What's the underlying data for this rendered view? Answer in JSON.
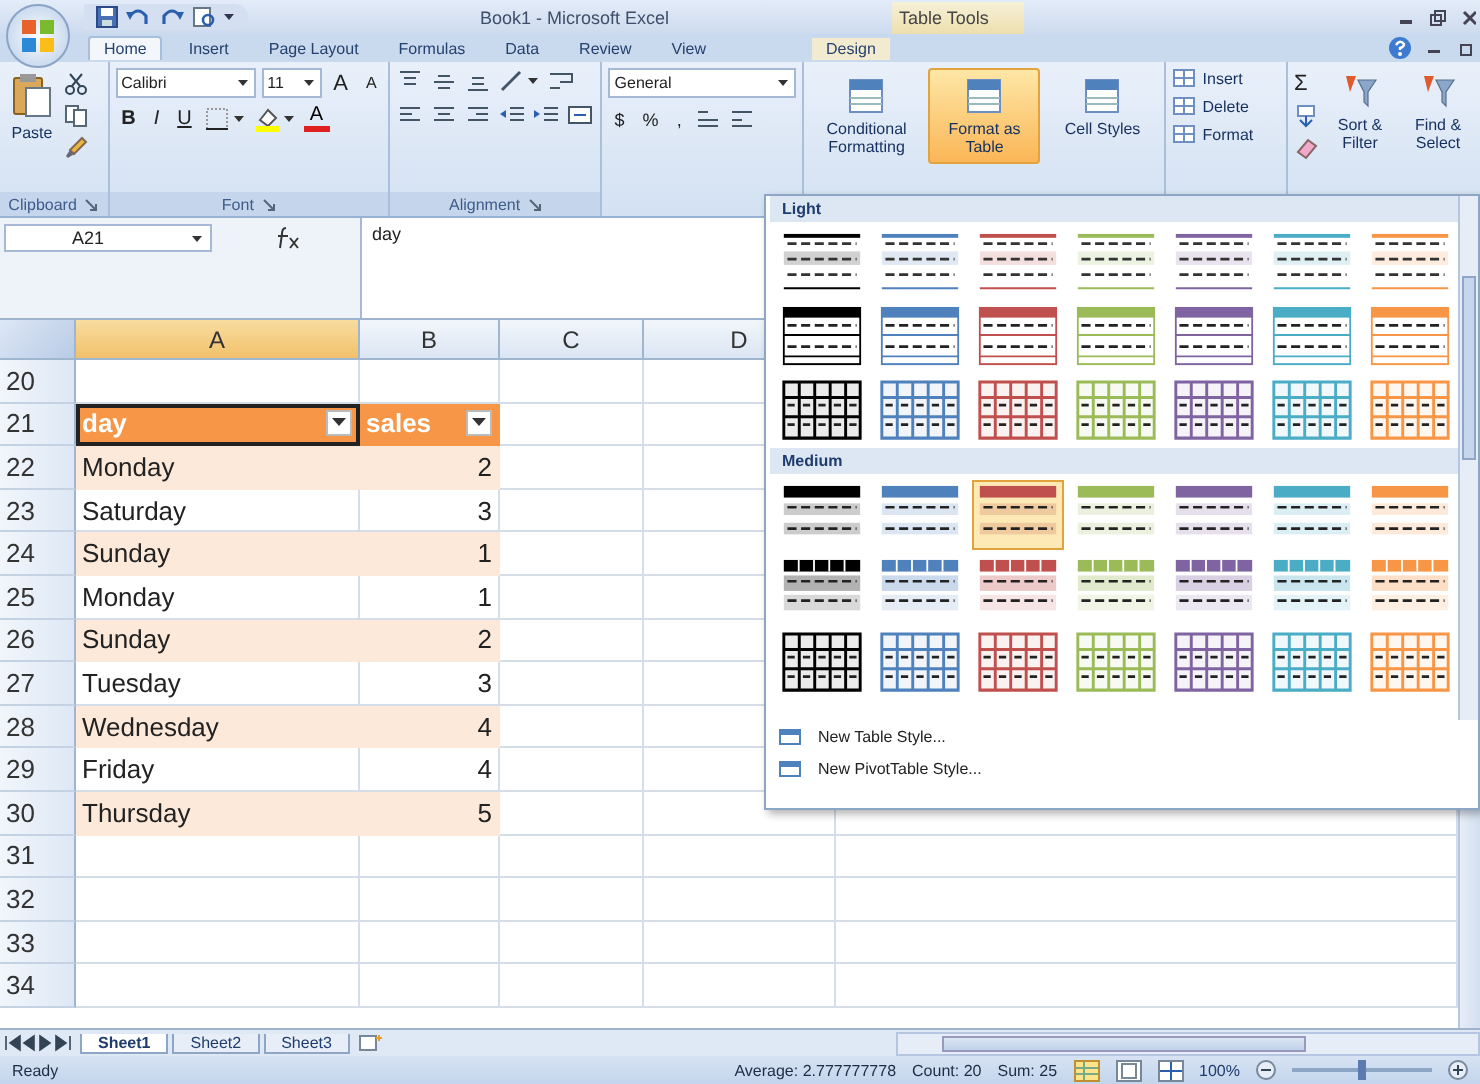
{
  "window": {
    "title": "Book1 - Microsoft Excel",
    "contextual_title": "Table Tools"
  },
  "tabs": [
    {
      "label": "Home",
      "selected": true,
      "kind": "normal"
    },
    {
      "label": "Insert",
      "selected": false,
      "kind": "normal"
    },
    {
      "label": "Page Layout",
      "selected": false,
      "kind": "normal"
    },
    {
      "label": "Formulas",
      "selected": false,
      "kind": "normal"
    },
    {
      "label": "Data",
      "selected": false,
      "kind": "normal"
    },
    {
      "label": "Review",
      "selected": false,
      "kind": "normal"
    },
    {
      "label": "View",
      "selected": false,
      "kind": "normal"
    },
    {
      "label": "Design",
      "selected": false,
      "kind": "contextual"
    }
  ],
  "ribbon": {
    "clipboard": {
      "paste": "Paste",
      "label": "Clipboard"
    },
    "font": {
      "name": "Calibri",
      "size": "11",
      "grow": "A",
      "shrink": "A",
      "styles": [
        "B",
        "I",
        "U"
      ],
      "color_letter": "A",
      "label": "Font"
    },
    "alignment": {
      "label": "Alignment"
    },
    "number": {
      "format": "General",
      "symbols": [
        "$",
        "%",
        ","
      ]
    },
    "styles": [
      {
        "label": "Conditional Formatting",
        "active": false
      },
      {
        "label": "Format as Table",
        "active": true
      },
      {
        "label": "Cell Styles",
        "active": false
      }
    ],
    "cells": [
      "Insert",
      "Delete",
      "Format"
    ],
    "editing": {
      "sum": "Σ",
      "buttons": [
        "Sort & Filter",
        "Find & Select"
      ]
    }
  },
  "name_box": "A21",
  "formula": "day",
  "columns": [
    "A",
    "B",
    "C",
    "D"
  ],
  "rows": [
    {
      "number": "20",
      "kind": "empty"
    },
    {
      "number": "21",
      "kind": "header",
      "day": "day",
      "sales": "sales"
    },
    {
      "number": "22",
      "kind": "data",
      "day": "Monday",
      "sales": "2",
      "banded": true
    },
    {
      "number": "23",
      "kind": "data",
      "day": "Saturday",
      "sales": "3",
      "banded": false
    },
    {
      "number": "24",
      "kind": "data",
      "day": "Sunday",
      "sales": "1",
      "banded": true
    },
    {
      "number": "25",
      "kind": "data",
      "day": "Monday",
      "sales": "1",
      "banded": false
    },
    {
      "number": "26",
      "kind": "data",
      "day": "Sunday",
      "sales": "2",
      "banded": true
    },
    {
      "number": "27",
      "kind": "data",
      "day": "Tuesday",
      "sales": "3",
      "banded": false
    },
    {
      "number": "28",
      "kind": "data",
      "day": "Wednesday",
      "sales": "4",
      "banded": true
    },
    {
      "number": "29",
      "kind": "data",
      "day": "Friday",
      "sales": "4",
      "banded": false
    },
    {
      "number": "30",
      "kind": "data",
      "day": "Thursday",
      "sales": "5",
      "banded": true
    },
    {
      "number": "31",
      "kind": "empty"
    },
    {
      "number": "32",
      "kind": "empty"
    },
    {
      "number": "33",
      "kind": "empty"
    },
    {
      "number": "34",
      "kind": "empty"
    }
  ],
  "gallery": {
    "sections": [
      {
        "title": "Light",
        "rows": [
          {
            "kind": "lines",
            "swatches": [
              {
                "color": "#000000",
                "selected": false
              },
              {
                "color": "#4f81bd",
                "selected": false
              },
              {
                "color": "#c0504d",
                "selected": false
              },
              {
                "color": "#9bbb59",
                "selected": false
              },
              {
                "color": "#8064a2",
                "selected": false
              },
              {
                "color": "#4bacc6",
                "selected": false
              },
              {
                "color": "#f79646",
                "selected": false
              }
            ]
          },
          {
            "kind": "header",
            "swatches": [
              {
                "color": "#000000",
                "selected": false
              },
              {
                "color": "#4f81bd",
                "selected": false
              },
              {
                "color": "#c0504d",
                "selected": false
              },
              {
                "color": "#9bbb59",
                "selected": false
              },
              {
                "color": "#8064a2",
                "selected": false
              },
              {
                "color": "#4bacc6",
                "selected": false
              },
              {
                "color": "#f79646",
                "selected": false
              }
            ]
          },
          {
            "kind": "grid",
            "swatches": [
              {
                "color": "#000000",
                "selected": false
              },
              {
                "color": "#4f81bd",
                "selected": false
              },
              {
                "color": "#c0504d",
                "selected": false
              },
              {
                "color": "#9bbb59",
                "selected": false
              },
              {
                "color": "#8064a2",
                "selected": false
              },
              {
                "color": "#4bacc6",
                "selected": false
              },
              {
                "color": "#f79646",
                "selected": false
              }
            ]
          }
        ]
      },
      {
        "title": "Medium",
        "rows": [
          {
            "kind": "filled",
            "swatches": [
              {
                "color": "#000000",
                "selected": false
              },
              {
                "color": "#4f81bd",
                "selected": false
              },
              {
                "color": "#c0504d",
                "selected": true
              },
              {
                "color": "#9bbb59",
                "selected": false
              },
              {
                "color": "#8064a2",
                "selected": false
              },
              {
                "color": "#4bacc6",
                "selected": false
              },
              {
                "color": "#f79646",
                "selected": false
              }
            ]
          },
          {
            "kind": "blocks",
            "swatches": [
              {
                "color": "#000000",
                "selected": false
              },
              {
                "color": "#4f81bd",
                "selected": false
              },
              {
                "color": "#c0504d",
                "selected": false
              },
              {
                "color": "#9bbb59",
                "selected": false
              },
              {
                "color": "#8064a2",
                "selected": false
              },
              {
                "color": "#4bacc6",
                "selected": false
              },
              {
                "color": "#f79646",
                "selected": false
              }
            ]
          },
          {
            "kind": "grid",
            "swatches": [
              {
                "color": "#000000",
                "selected": false
              },
              {
                "color": "#4f81bd",
                "selected": false
              },
              {
                "color": "#c0504d",
                "selected": false
              },
              {
                "color": "#9bbb59",
                "selected": false
              },
              {
                "color": "#8064a2",
                "selected": false
              },
              {
                "color": "#4bacc6",
                "selected": false
              },
              {
                "color": "#f79646",
                "selected": false
              }
            ]
          }
        ]
      }
    ],
    "menu": [
      "New Table Style...",
      "New PivotTable Style..."
    ]
  },
  "sheet_tabs": [
    {
      "label": "Sheet1",
      "selected": true
    },
    {
      "label": "Sheet2",
      "selected": false
    },
    {
      "label": "Sheet3",
      "selected": false
    }
  ],
  "status_bar": {
    "mode": "Ready",
    "average": "Average: 2.777777778",
    "count": "Count: 20",
    "sum": "Sum: 25",
    "zoom": "100%",
    "zoom_slider": {
      "level": 0.5
    }
  }
}
